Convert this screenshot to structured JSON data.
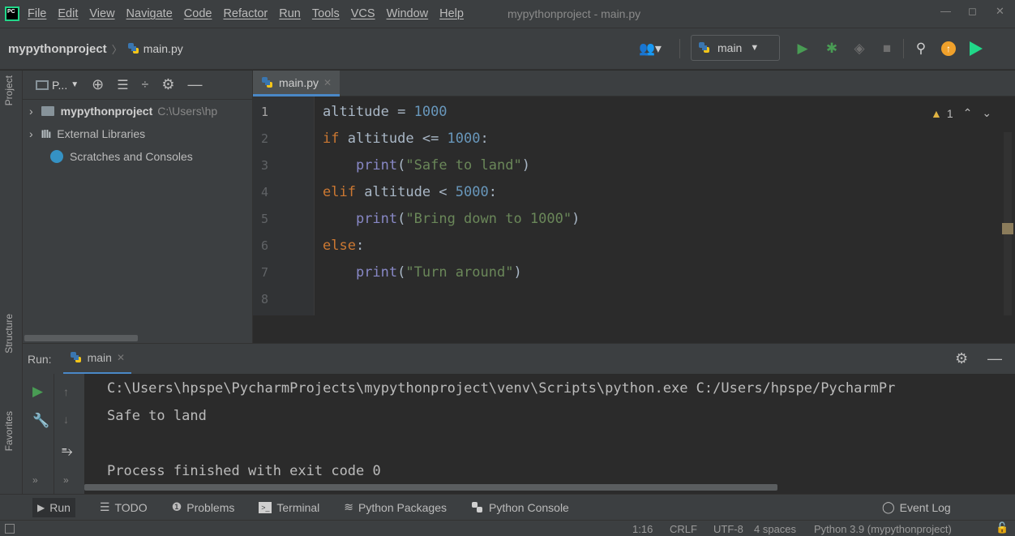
{
  "menu": {
    "logo_text": "PC",
    "items": [
      "File",
      "Edit",
      "View",
      "Navigate",
      "Code",
      "Refactor",
      "Run",
      "Tools",
      "VCS",
      "Window",
      "Help"
    ],
    "window_title": "mypythonproject - main.py"
  },
  "navbar": {
    "project": "mypythonproject",
    "file": "main.py",
    "branch": "main"
  },
  "side_tabs": {
    "project": "Project",
    "structure": "Structure",
    "favorites": "Favorites"
  },
  "project_panel": {
    "dropdown_label": "P...",
    "tree": [
      {
        "label": "mypythonproject",
        "path": "C:\\Users\\hp"
      },
      {
        "label": "External Libraries",
        "path": ""
      },
      {
        "label": "Scratches and Consoles",
        "path": ""
      }
    ]
  },
  "editor": {
    "tab_label": "main.py",
    "inspection_count": "1",
    "line_numbers": [
      "1",
      "2",
      "3",
      "4",
      "5",
      "6",
      "7",
      "8"
    ]
  },
  "run": {
    "label": "Run:",
    "config_tab": "main",
    "console_lines": [
      "C:\\Users\\hpspe\\PycharmProjects\\mypythonproject\\venv\\Scripts\\python.exe C:/Users/hpspe/PycharmPr",
      "Safe to land",
      "",
      "Process finished with exit code 0"
    ]
  },
  "bottom_tabs": [
    "Run",
    "TODO",
    "Problems",
    "Terminal",
    "Python Packages",
    "Python Console"
  ],
  "event_log": "Event Log",
  "status": {
    "position": "1:16",
    "line_sep": "CRLF",
    "encoding": "UTF-8",
    "indent": "4 spaces",
    "interpreter": "Python 3.9 (mypythonproject)"
  },
  "colors": {
    "accent_blue": "#4a88c7",
    "run_green": "#499c54",
    "keyword": "#cc7832",
    "number": "#6897bb",
    "string": "#6a8759",
    "builtin": "#8888c6"
  }
}
